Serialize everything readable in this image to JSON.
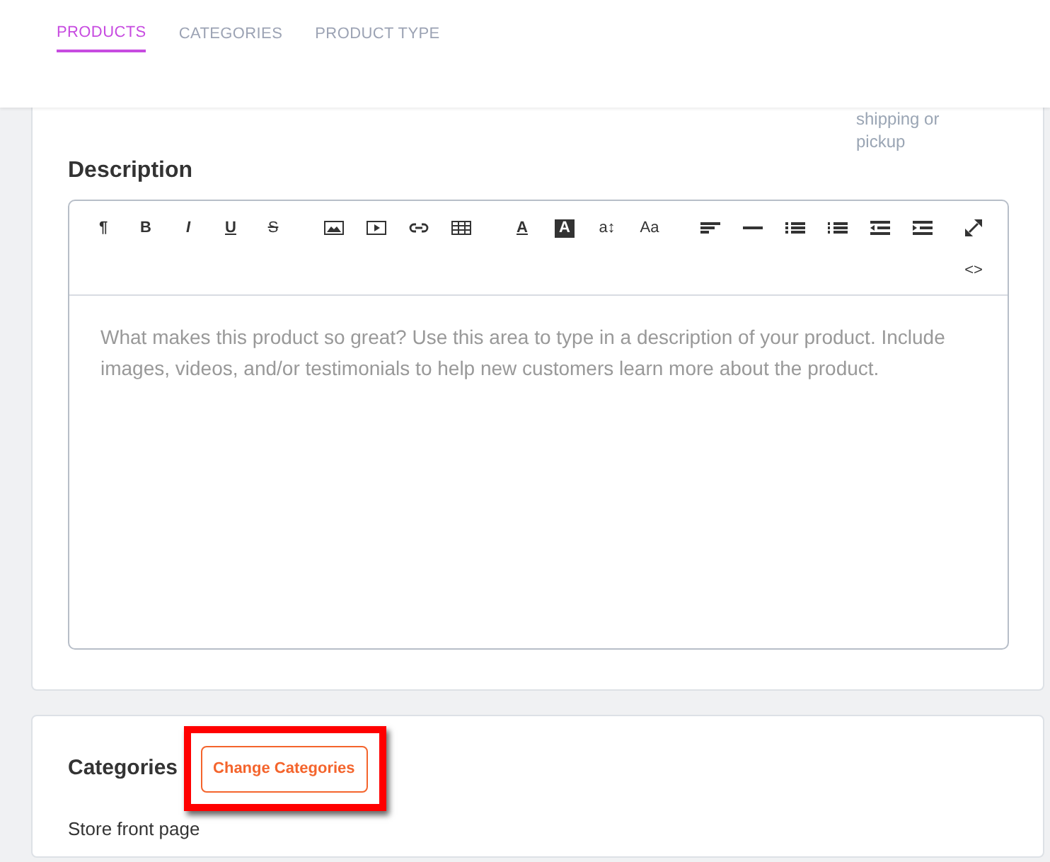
{
  "tabs": [
    {
      "label": "PRODUCTS",
      "selected": true
    },
    {
      "label": "CATEGORIES",
      "selected": false
    },
    {
      "label": "PRODUCT TYPE",
      "selected": false
    }
  ],
  "side_note": [
    "shipping or",
    "pickup"
  ],
  "description": {
    "title": "Description",
    "toolbar": [
      {
        "kind": "glyph",
        "label": "¶"
      },
      {
        "kind": "glyph",
        "label": "B"
      },
      {
        "kind": "glyph",
        "label": "I"
      },
      {
        "kind": "glyph",
        "label": "U"
      },
      {
        "kind": "glyph",
        "label": "S"
      },
      {
        "kind": "gap"
      },
      {
        "kind": "icon"
      },
      {
        "kind": "icon"
      },
      {
        "kind": "icon"
      },
      {
        "kind": "icon"
      },
      {
        "kind": "gap"
      },
      {
        "kind": "glyph",
        "label": "A"
      },
      {
        "kind": "glyph-inverse",
        "label": "A"
      },
      {
        "kind": "glyph",
        "label": "a↕"
      },
      {
        "kind": "glyph",
        "label": "Aa"
      },
      {
        "kind": "gap"
      },
      {
        "kind": "icon"
      },
      {
        "kind": "icon"
      },
      {
        "kind": "icon"
      },
      {
        "kind": "icon"
      },
      {
        "kind": "icon"
      },
      {
        "kind": "icon"
      }
    ],
    "code_view": "<>",
    "placeholder": "What makes this product so great? Use this area to type in a description of your product. Include images, videos, and/or testimonials to help new customers learn more about the product."
  },
  "categories": {
    "title": "Categories",
    "button": "Change Categories",
    "highlighted": true,
    "items": [
      "Store front page"
    ]
  }
}
